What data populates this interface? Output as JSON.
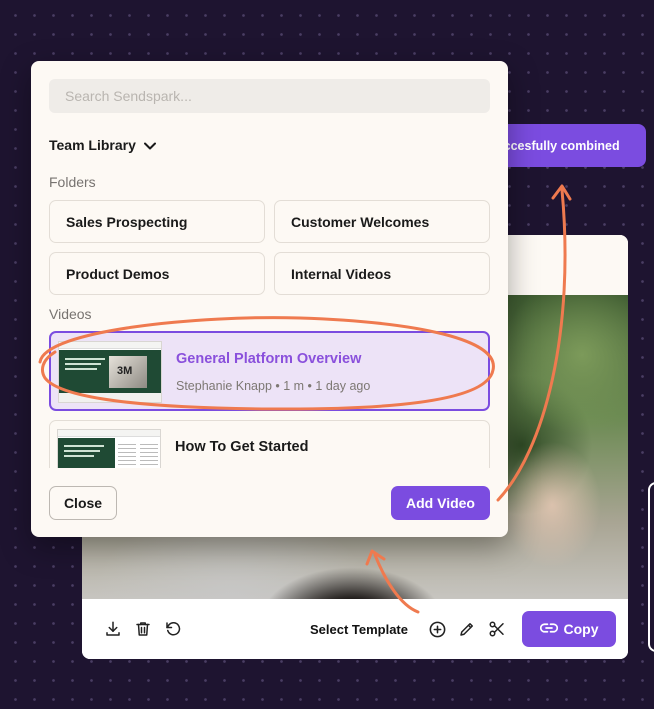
{
  "modal": {
    "search_placeholder": "Search Sendspark...",
    "library_label": "Team Library",
    "folders_heading": "Folders",
    "folders": [
      {
        "label": "Sales Prospecting"
      },
      {
        "label": "Customer Welcomes"
      },
      {
        "label": "Product Demos"
      },
      {
        "label": "Internal Videos"
      }
    ],
    "videos_heading": "Videos",
    "videos": [
      {
        "title": "General Platform Overview",
        "meta": "Stephanie Knapp • 1 m • 1 day ago",
        "selected": true
      },
      {
        "title": "How To Get Started",
        "meta": "",
        "selected": false
      }
    ],
    "close_label": "Close",
    "add_label": "Add Video"
  },
  "toast": {
    "message": "Your videos have been succesfully combined"
  },
  "editor": {
    "select_template_label": "Select Template",
    "copy_label": "Copy"
  },
  "colors": {
    "accent": "#7b4ce0",
    "annotation": "#ef7a4f",
    "background": "#1e1430"
  },
  "icons": [
    "download-icon",
    "trash-icon",
    "undo-icon",
    "plus-circle-icon",
    "pencil-icon",
    "scissors-icon",
    "link-icon",
    "chevron-down-icon"
  ]
}
